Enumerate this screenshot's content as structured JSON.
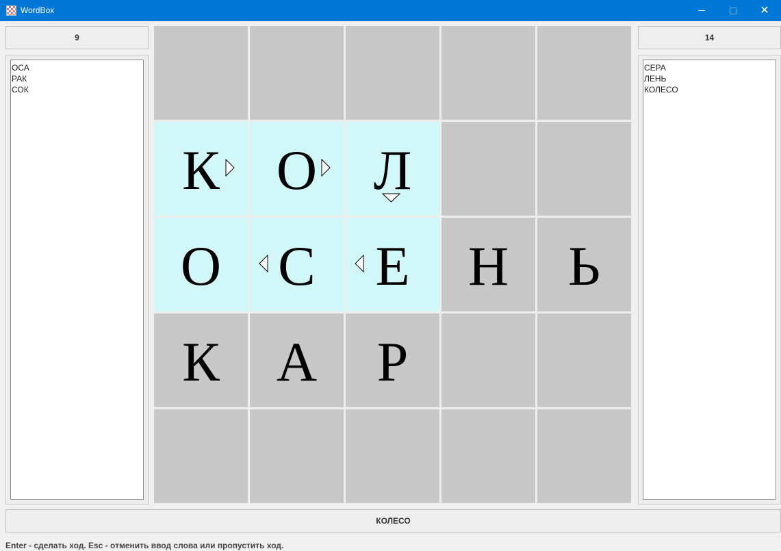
{
  "window": {
    "title": "WordBox",
    "close_symbol": "✕"
  },
  "player_left": {
    "score": "9",
    "words": [
      "ОСА",
      "РАК",
      "СОК"
    ]
  },
  "player_right": {
    "score": "14",
    "words": [
      "СЕРА",
      "ЛЕНЬ",
      "КОЛЕСО"
    ]
  },
  "board": {
    "rows": [
      [
        "",
        "",
        "",
        "",
        ""
      ],
      [
        "К",
        "О",
        "Л",
        "",
        ""
      ],
      [
        "О",
        "С",
        "Е",
        "Н",
        "Ь"
      ],
      [
        "К",
        "А",
        "Р",
        "",
        ""
      ],
      [
        "",
        "",
        "",
        "",
        ""
      ]
    ],
    "highlight_color": "#d1f7f8",
    "cell_color": "#c8c8c8"
  },
  "current_word": "КОЛЕСО",
  "status": "Enter - сделать ход. Esc - отменить ввод слова или пропустить ход."
}
